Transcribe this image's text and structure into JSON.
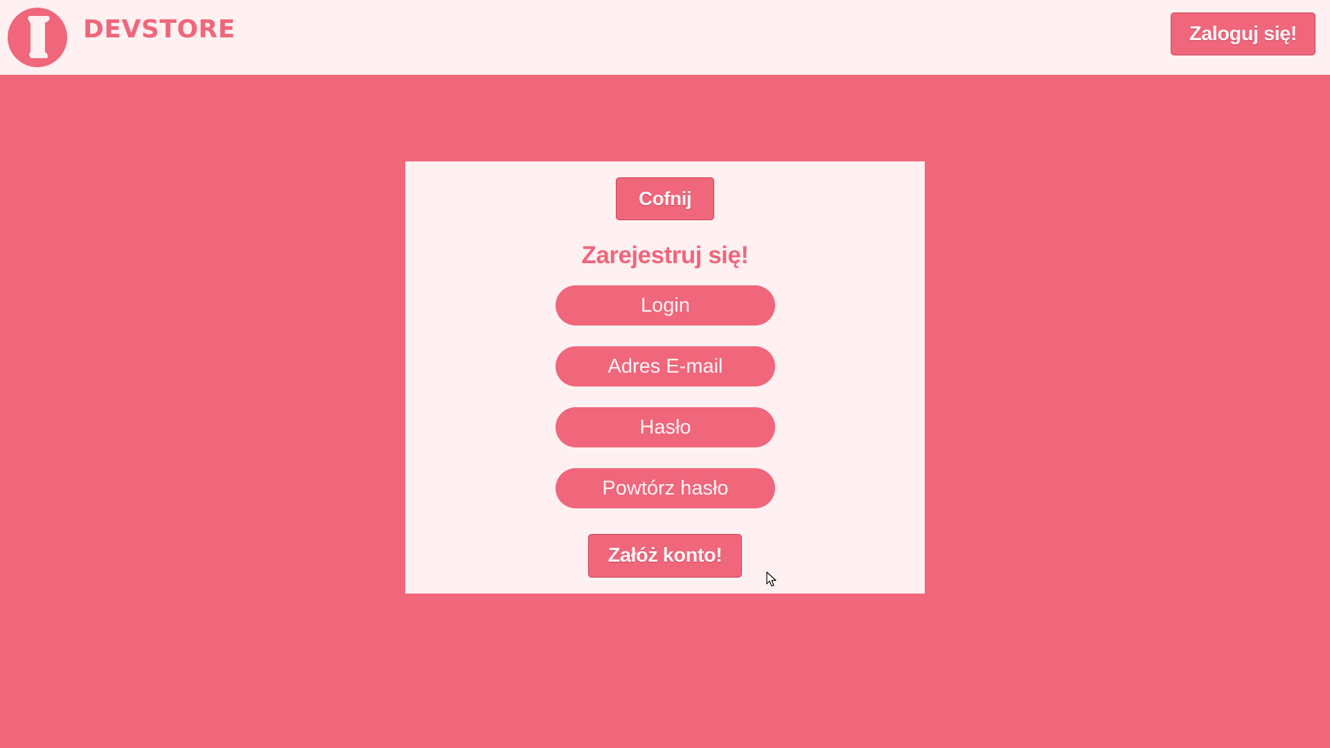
{
  "header": {
    "brand": "DEVSTORE",
    "logo_icon": "scroll-icon",
    "login_button": "Zaloguj się!"
  },
  "form": {
    "back_button": "Cofnij",
    "title": "Zarejestruj się!",
    "fields": {
      "login": {
        "placeholder": "Login",
        "value": ""
      },
      "email": {
        "placeholder": "Adres E-mail",
        "value": ""
      },
      "password": {
        "placeholder": "Hasło",
        "value": ""
      },
      "repeat_password": {
        "placeholder": "Powtórz hasło",
        "value": ""
      }
    },
    "submit_button": "Załóż konto!"
  },
  "colors": {
    "accent": "#f0667b",
    "background_light": "#fff0f1",
    "button_text": "#fff4f5"
  }
}
